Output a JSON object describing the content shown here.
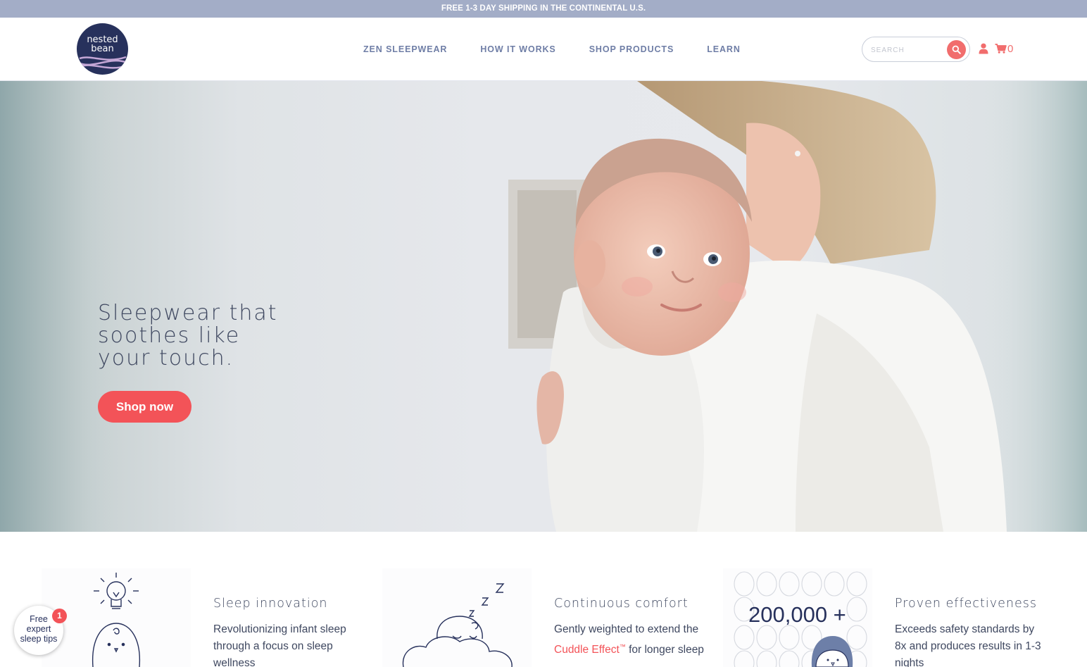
{
  "announcement": "FREE 1-3 DAY SHIPPING IN THE CONTINENTAL U.S.",
  "logo": {
    "line1": "nested",
    "line2": "bean"
  },
  "nav": [
    "ZEN SLEEPWEAR",
    "HOW IT WORKS",
    "SHOP PRODUCTS",
    "LEARN"
  ],
  "search": {
    "placeholder": "SEARCH",
    "icon": "search-icon"
  },
  "account": {
    "icon": "user-icon"
  },
  "cart": {
    "icon": "cart-icon",
    "count": "0"
  },
  "hero": {
    "title_lines": [
      "Sleepwear that",
      "soothes like",
      "your touch."
    ],
    "cta": "Shop now"
  },
  "features": [
    {
      "title": "Sleep innovation",
      "desc": "Revolutionizing infant sleep through a focus on sleep wellness",
      "icon": "lightbulb-baby-icon"
    },
    {
      "title": "Continuous comfort",
      "desc_before": "Gently weighted to extend the ",
      "desc_highlight": "Cuddle Effect",
      "desc_tm": "™",
      "desc_after": " for longer sleep",
      "icon": "sleeping-cloud-icon"
    },
    {
      "title": "Proven effectiveness",
      "desc": "Exceeds safety standards by 8x and produces results in 1-3 nights",
      "icon": "eggs-baby-icon",
      "counter": "200,000 +"
    }
  ],
  "tips_widget": {
    "lines": [
      "Free",
      "expert",
      "sleep tips"
    ],
    "badge": "1"
  },
  "colors": {
    "accent": "#f35358",
    "navy": "#27315c",
    "nav_text": "#6f7ea6",
    "announce_bg": "#a3adc7"
  }
}
